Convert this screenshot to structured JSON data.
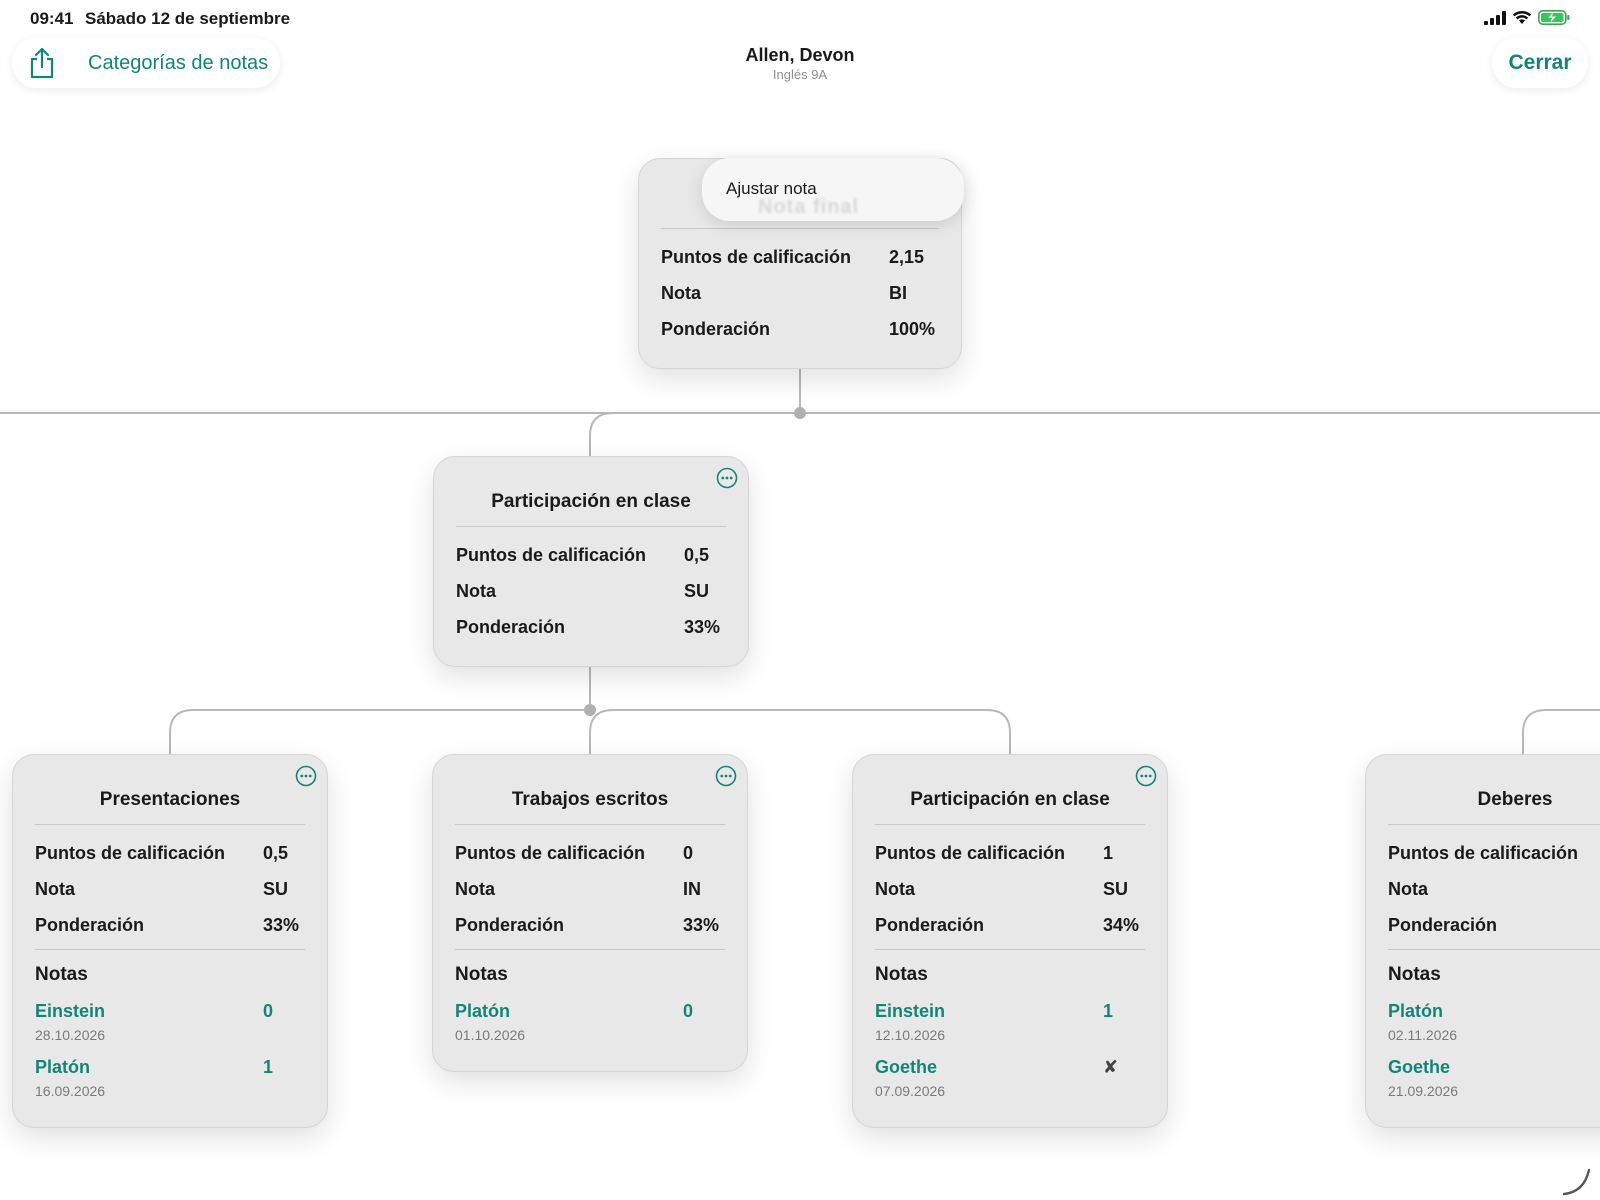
{
  "status_bar": {
    "time": "09:41",
    "date": "Sábado 12 de septiembre"
  },
  "toolbar": {
    "categories_label": "Categorías de notas",
    "close_label": "Cerrar"
  },
  "header": {
    "title": "Allen, Devon",
    "subtitle": "Inglés 9A"
  },
  "colors": {
    "accent": "#14847b",
    "card_bg": "#e8e8e8",
    "connector": "#b8b8b8"
  },
  "root_card": {
    "menu_label": "Ajustar nota",
    "blurred_title": "Nota final",
    "rows": [
      {
        "label": "Puntos de calificación",
        "value": "2,15"
      },
      {
        "label": "Nota",
        "value": "BI"
      },
      {
        "label": "Ponderación",
        "value": "100%"
      }
    ]
  },
  "cards": {
    "participation_parent": {
      "title": "Participación en clase",
      "rows": [
        {
          "label": "Puntos de calificación",
          "value": "0,5"
        },
        {
          "label": "Nota",
          "value": "SU"
        },
        {
          "label": "Ponderación",
          "value": "33%"
        }
      ]
    },
    "presentations": {
      "title": "Presentaciones",
      "rows": [
        {
          "label": "Puntos de calificación",
          "value": "0,5"
        },
        {
          "label": "Nota",
          "value": "SU"
        },
        {
          "label": "Ponderación",
          "value": "33%"
        }
      ],
      "notes_heading": "Notas",
      "notes": [
        {
          "name": "Einstein",
          "value": "0",
          "date": "28.10.2026"
        },
        {
          "name": "Platón",
          "value": "1",
          "date": "16.09.2026"
        }
      ]
    },
    "written_work": {
      "title": "Trabajos escritos",
      "rows": [
        {
          "label": "Puntos de calificación",
          "value": "0"
        },
        {
          "label": "Nota",
          "value": "IN"
        },
        {
          "label": "Ponderación",
          "value": "33%"
        }
      ],
      "notes_heading": "Notas",
      "notes": [
        {
          "name": "Platón",
          "value": "0",
          "date": "01.10.2026"
        }
      ]
    },
    "participation_child": {
      "title": "Participación en clase",
      "rows": [
        {
          "label": "Puntos de calificación",
          "value": "1"
        },
        {
          "label": "Nota",
          "value": "SU"
        },
        {
          "label": "Ponderación",
          "value": "34%"
        }
      ],
      "notes_heading": "Notas",
      "notes": [
        {
          "name": "Einstein",
          "value": "1",
          "date": "12.10.2026"
        },
        {
          "name": "Goethe",
          "value": "✘",
          "date": "07.09.2026"
        }
      ]
    },
    "homework": {
      "title": "Deberes",
      "rows": [
        {
          "label": "Puntos de calificación"
        },
        {
          "label": "Nota"
        },
        {
          "label": "Ponderación"
        }
      ],
      "notes_heading": "Notas",
      "notes": [
        {
          "name": "Platón",
          "date": "02.11.2026"
        },
        {
          "name": "Goethe",
          "date": "21.09.2026"
        }
      ]
    }
  }
}
